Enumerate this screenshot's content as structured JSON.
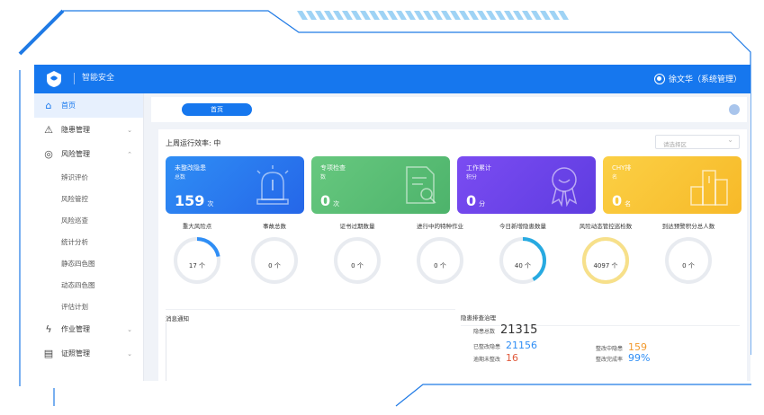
{
  "app": {
    "title": "智能安全",
    "user": "徐文华（系统管理）"
  },
  "sidebar": {
    "items": [
      {
        "label": "首页",
        "icon": "home-icon",
        "glyph": "⌂",
        "active": true
      },
      {
        "label": "隐患管理",
        "icon": "warning-icon",
        "glyph": "⚠",
        "chevron": true
      },
      {
        "label": "风险管理",
        "icon": "shield-icon",
        "glyph": "◎",
        "chevron": true
      }
    ],
    "sub_items": [
      "辨识评价",
      "风险管控",
      "风险巡查",
      "统计分析",
      "静态四色图",
      "动态四色图",
      "评估计划"
    ],
    "items_after": [
      {
        "label": "作业管理",
        "icon": "lightning-icon",
        "glyph": "ϟ",
        "chevron": true
      },
      {
        "label": "证照管理",
        "icon": "document-icon",
        "glyph": "▤",
        "chevron": true
      }
    ]
  },
  "tabs": {
    "home_label": "首页"
  },
  "summary": {
    "label": "上周运行效率: 中",
    "select_placeholder": "请选择区"
  },
  "cards": [
    {
      "label1": "未整改隐患",
      "label2": "总数",
      "value": "159",
      "unit": "次",
      "color_from": "#2f8ef5",
      "color_to": "#2566e8",
      "icon": "alarm-icon"
    },
    {
      "label1": "专项检查",
      "label2": "数",
      "value": "0",
      "unit": "次",
      "color_from": "#67c87f",
      "color_to": "#4db36b",
      "icon": "report-search-icon"
    },
    {
      "label1": "工作累计",
      "label2": "积分",
      "value": "0",
      "unit": "分",
      "color_from": "#7b4cf2",
      "color_to": "#5e3ce0",
      "icon": "award-icon"
    },
    {
      "label1": "CHY排",
      "label2": "名",
      "value": "0",
      "unit": "名",
      "color_from": "#fbd045",
      "color_to": "#f7b928",
      "icon": "podium-icon"
    }
  ],
  "stats": [
    {
      "title": "重大风险点",
      "value": "17 个",
      "fill": 0.22,
      "color": "#2f8ef5"
    },
    {
      "title": "事故总数",
      "value": "0 个",
      "fill": 0,
      "color": "#2f8ef5"
    },
    {
      "title": "证书过期数量",
      "value": "0 个",
      "fill": 0,
      "color": "#2f8ef5"
    },
    {
      "title": "进行中的特种作业",
      "value": "0 个",
      "fill": 0,
      "color": "#2f8ef5"
    },
    {
      "title": "今日新增隐患数量",
      "value": "40 个",
      "fill": 0.42,
      "color": "#27aae1"
    },
    {
      "title": "风险动态管控巡检数",
      "value": "4097 个",
      "fill": 1,
      "color": "#f7e08a"
    },
    {
      "title": "到达预警积分总人数",
      "value": "0 个",
      "fill": 0,
      "color": "#2f8ef5"
    }
  ],
  "notices": {
    "title": "消息通知"
  },
  "hazards": {
    "title": "隐患排查治理",
    "total_label": "隐患总数",
    "total_value": "21315",
    "rectified_label": "已整改隐患",
    "rectified_value": "21156",
    "overdue_label": "逾期未整改",
    "overdue_value": "16",
    "pending_label": "整改中隐患",
    "pending_value": "159",
    "rate_label": "整改完成率",
    "rate_value": "99%",
    "colors": {
      "total": "#333333",
      "rectified": "#2f8ef5",
      "overdue": "#e05a3c",
      "pending": "#f29a2e",
      "rate": "#2f8ef5"
    }
  }
}
